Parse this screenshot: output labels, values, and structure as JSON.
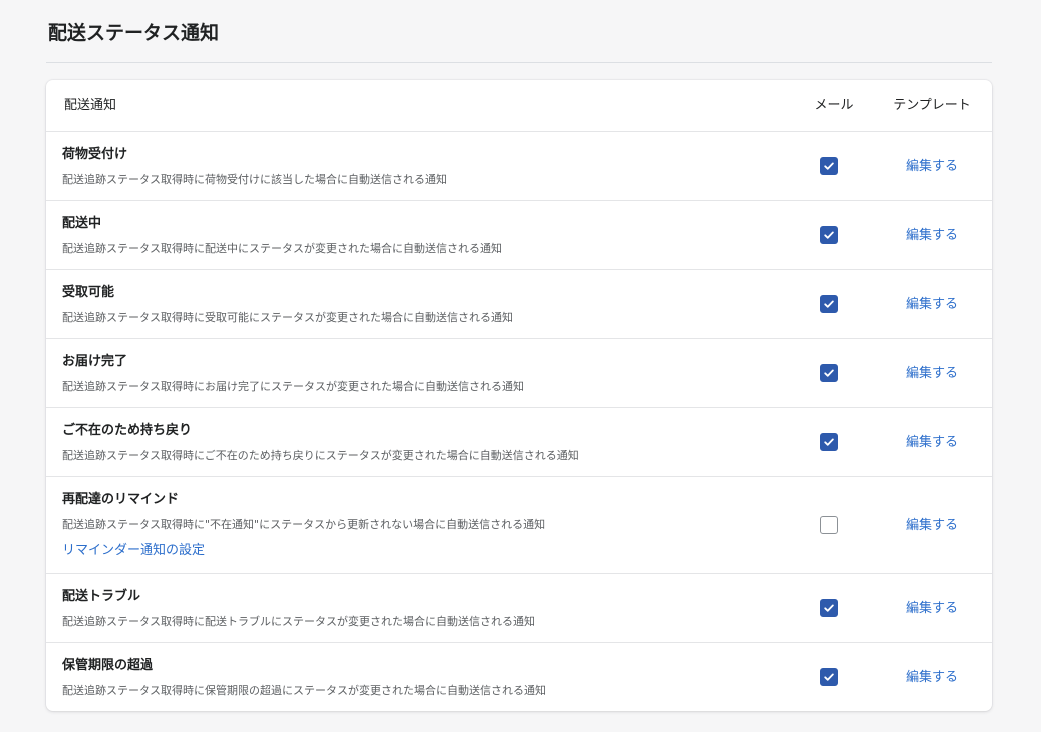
{
  "page": {
    "title": "配送ステータス通知"
  },
  "table": {
    "headers": {
      "name": "配送通知",
      "mail": "メール",
      "template": "テンプレート"
    },
    "rows": [
      {
        "title": "荷物受付け",
        "description": "配送追跡ステータス取得時に荷物受付けに該当した場合に自動送信される通知",
        "mail_checked": true,
        "edit_label": "編集する"
      },
      {
        "title": "配送中",
        "description": "配送追跡ステータス取得時に配送中にステータスが変更された場合に自動送信される通知",
        "mail_checked": true,
        "edit_label": "編集する"
      },
      {
        "title": "受取可能",
        "description": "配送追跡ステータス取得時に受取可能にステータスが変更された場合に自動送信される通知",
        "mail_checked": true,
        "edit_label": "編集する"
      },
      {
        "title": "お届け完了",
        "description": "配送追跡ステータス取得時にお届け完了にステータスが変更された場合に自動送信される通知",
        "mail_checked": true,
        "edit_label": "編集する"
      },
      {
        "title": "ご不在のため持ち戻り",
        "description": "配送追跡ステータス取得時にご不在のため持ち戻りにステータスが変更された場合に自動送信される通知",
        "mail_checked": true,
        "edit_label": "編集する"
      },
      {
        "title": "再配達のリマインド",
        "description": "配送追跡ステータス取得時に\"不在通知\"にステータスから更新されない場合に自動送信される通知",
        "link": "リマインダー通知の設定",
        "mail_checked": false,
        "edit_label": "編集する"
      },
      {
        "title": "配送トラブル",
        "description": "配送追跡ステータス取得時に配送トラブルにステータスが変更された場合に自動送信される通知",
        "mail_checked": true,
        "edit_label": "編集する"
      },
      {
        "title": "保管期限の超過",
        "description": "配送追跡ステータス取得時に保管期限の超過にステータスが変更された場合に自動送信される通知",
        "mail_checked": true,
        "edit_label": "編集する"
      }
    ]
  },
  "colors": {
    "accent": "#2e5aac",
    "link": "#2c6ecb",
    "background": "#f6f6f7"
  },
  "icons": {
    "checked": "checkmark-icon"
  }
}
